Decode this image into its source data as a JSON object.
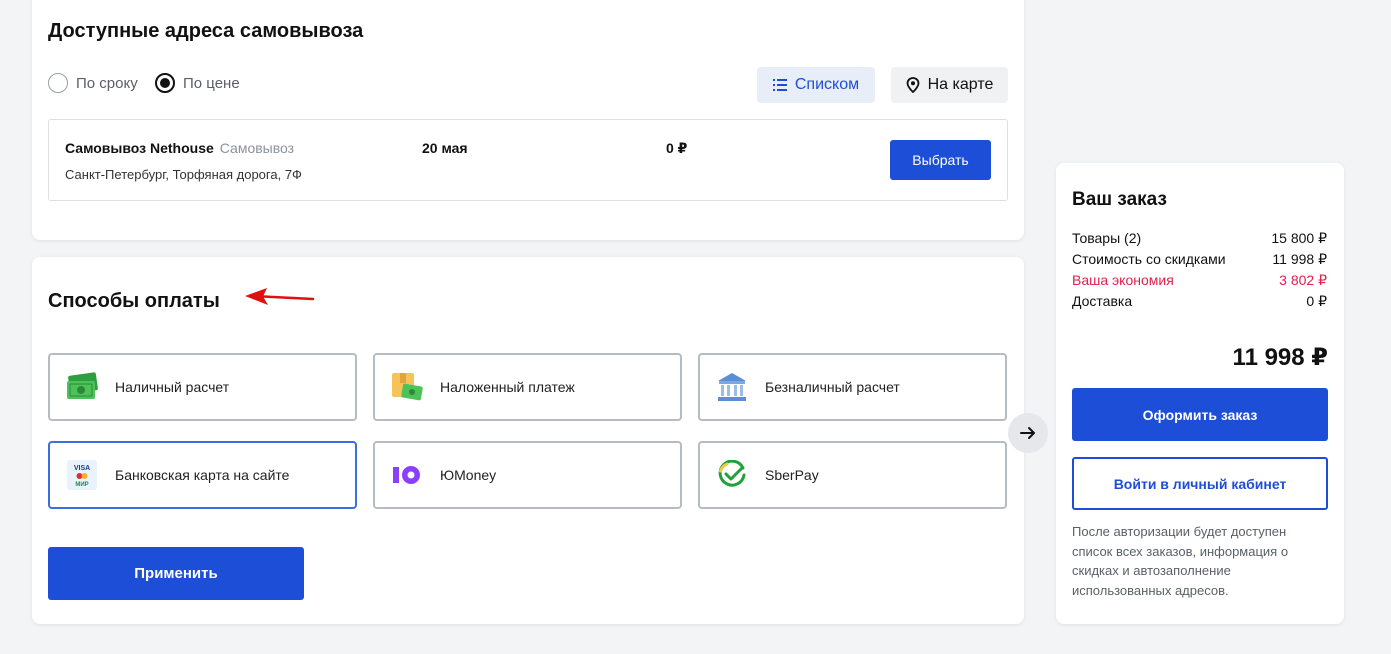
{
  "pickup": {
    "title": "Доступные адреса самовывоза",
    "sort_by_term": "По сроку",
    "sort_by_price": "По цене",
    "view_list": "Списком",
    "view_map": "На карте",
    "point": {
      "name": "Самовывоз Nethouse",
      "type": "Самовывоз",
      "date": "20 мая",
      "price": "0 ₽",
      "address": "Санкт-Петербург, Торфяная дорога, 7Ф",
      "select_label": "Выбрать"
    }
  },
  "payment": {
    "title": "Способы оплаты",
    "options": [
      {
        "label": "Наличный расчет",
        "icon": "cash-icon"
      },
      {
        "label": "Наложенный платеж",
        "icon": "cod-parcel-icon"
      },
      {
        "label": "Безналичный расчет",
        "icon": "bank-icon"
      },
      {
        "label": "Банковская карта на сайте",
        "icon": "bank-card-icon",
        "selected": true
      },
      {
        "label": "ЮMoney",
        "icon": "yoomoney-icon"
      },
      {
        "label": "SberPay",
        "icon": "sberpay-icon"
      }
    ],
    "apply_label": "Применить"
  },
  "order": {
    "title": "Ваш заказ",
    "rows": [
      {
        "label": "Товары (2)",
        "value": "15 800 ₽"
      },
      {
        "label": "Стоимость со скидками",
        "value": "11 998 ₽"
      },
      {
        "label": "Ваша экономия",
        "value": "3 802 ₽"
      },
      {
        "label": "Доставка",
        "value": "0 ₽"
      }
    ],
    "total": "11 998 ₽",
    "checkout_label": "Оформить заказ",
    "login_label": "Войти в личный кабинет",
    "login_note": "После авторизации будет доступен список всех заказов, информация о скидках и автозаполнение использованных адресов."
  },
  "colors": {
    "accent": "#1d4ed8",
    "discount": "#e0204f",
    "annotation_arrow": "#e01010"
  }
}
